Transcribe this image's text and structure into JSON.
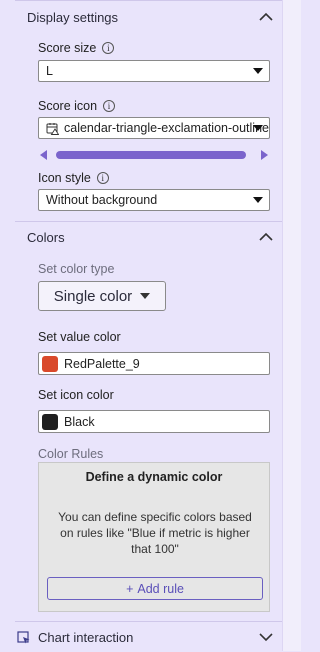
{
  "display_settings": {
    "title": "Display settings",
    "score_size": {
      "label": "Score size",
      "value": "L"
    },
    "score_icon": {
      "label": "Score icon",
      "value": "calendar-triangle-exclamation-outline"
    },
    "icon_style": {
      "label": "Icon style",
      "value": "Without background"
    }
  },
  "colors": {
    "title": "Colors",
    "set_color_type": {
      "label": "Set color type",
      "value": "Single color"
    },
    "set_value_color": {
      "label": "Set value color",
      "value": "RedPalette_9",
      "swatch": "#d9492b"
    },
    "set_icon_color": {
      "label": "Set icon color",
      "value": "Black",
      "swatch": "#1f1f1f"
    },
    "color_rules": {
      "label": "Color Rules",
      "title": "Define a dynamic color",
      "description": "You can define specific colors based on rules like \"Blue if metric is higher that 100\"",
      "add_rule": "Add rule",
      "add_symbol": "+"
    }
  },
  "chart_interaction": {
    "title": "Chart interaction"
  },
  "theme": {
    "accent": "#7b64cc",
    "panel_bg": "#e9e4fb"
  }
}
